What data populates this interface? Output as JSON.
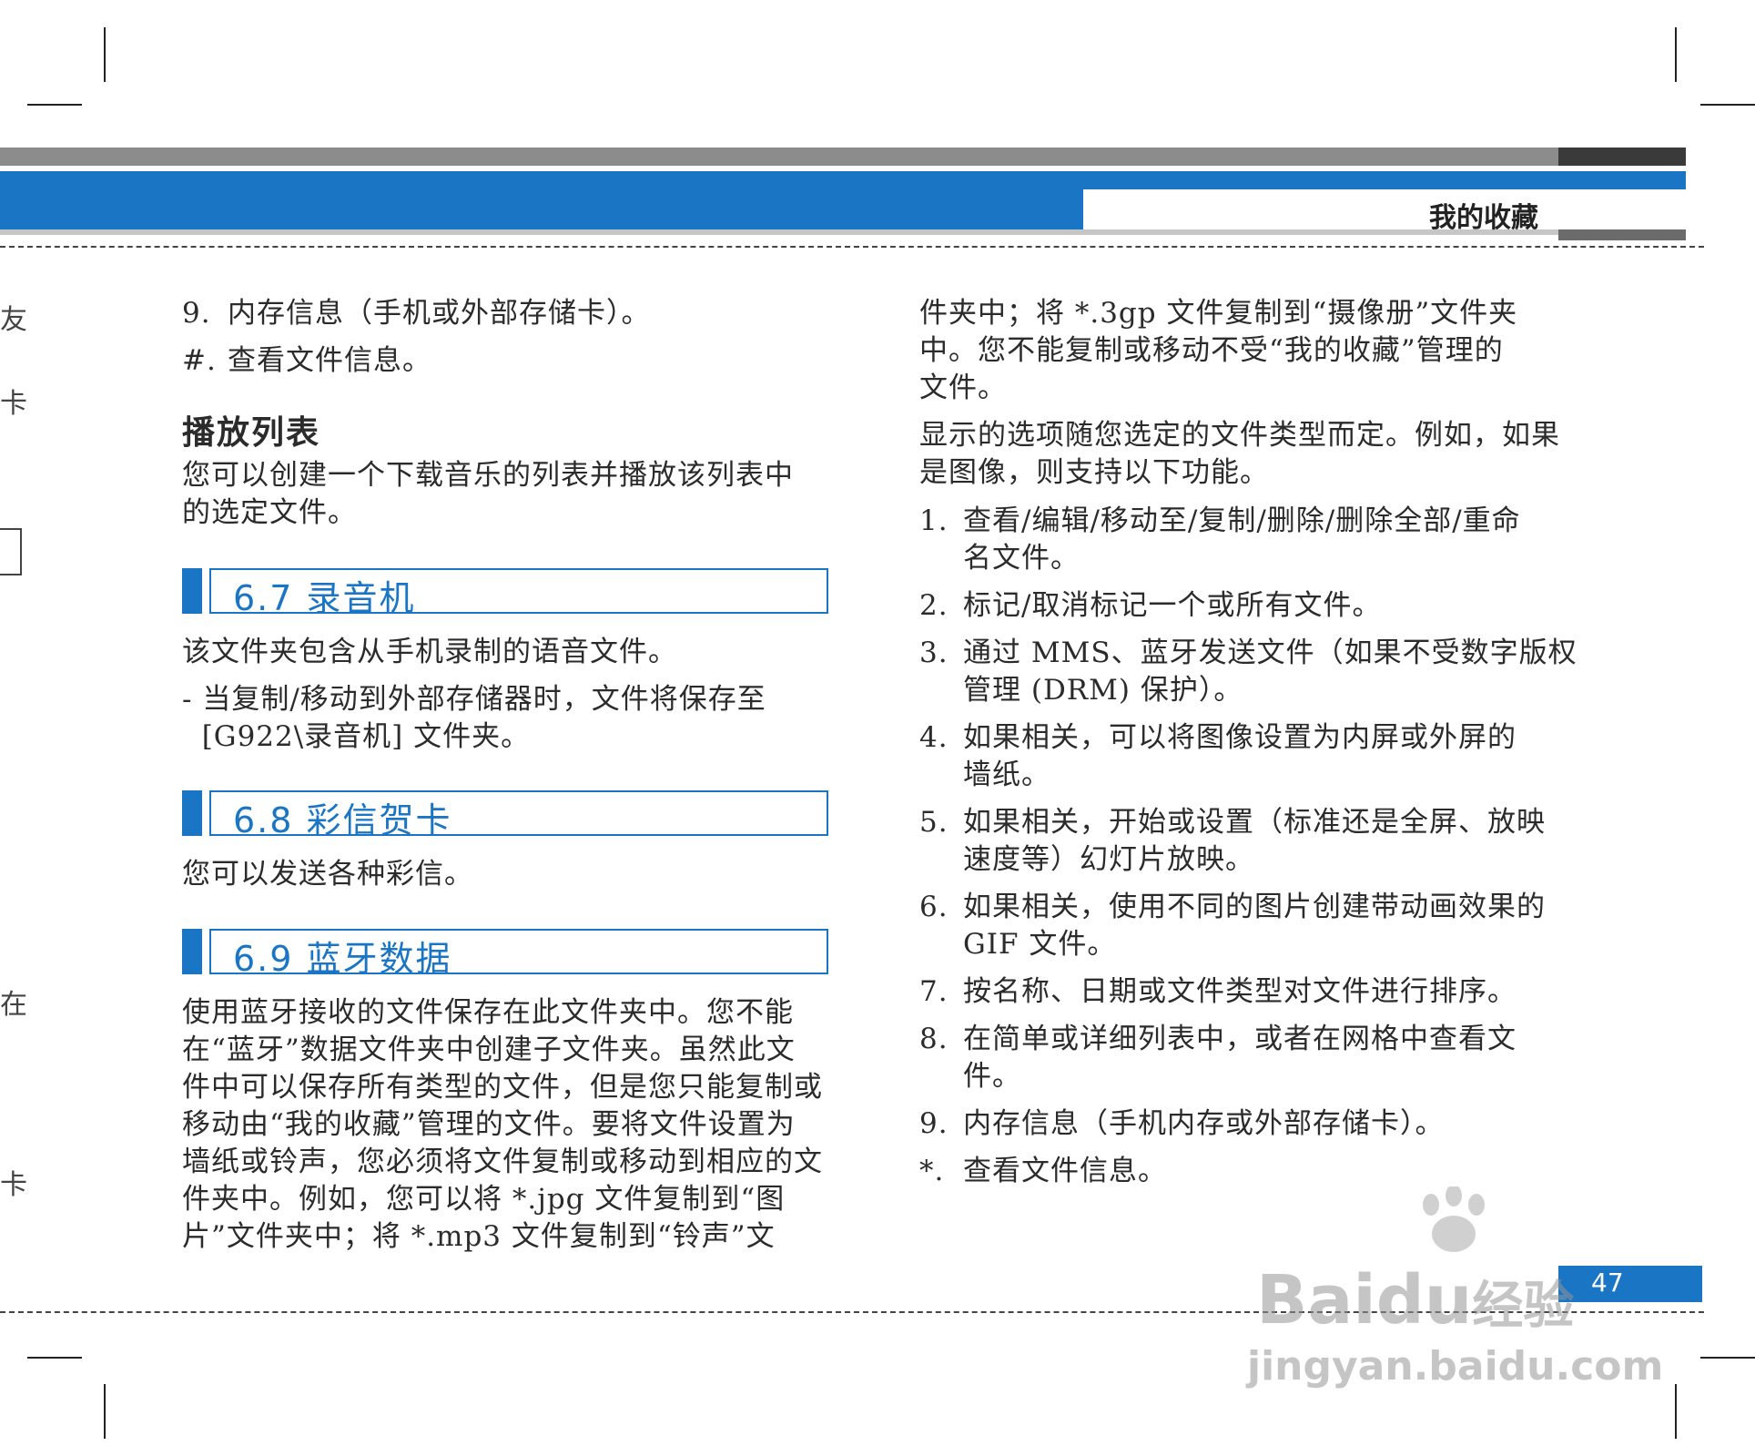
{
  "header": {
    "title": "我的收藏"
  },
  "left_edge": {
    "chars": [
      "友",
      "卡",
      "在",
      "卡"
    ]
  },
  "left": {
    "top_items": [
      {
        "num": "9.",
        "text": "内存信息（手机或外部存储卡）。"
      },
      {
        "num": "#.",
        "text": "查看文件信息。"
      }
    ],
    "playlist_heading": "播放列表",
    "playlist_text": [
      "您可以创建一个下载音乐的列表并播放该列表中",
      "的选定文件。"
    ],
    "sec67": {
      "title": "6.7 录音机",
      "lines": [
        "该文件夹包含从手机录制的语音文件。"
      ],
      "bullet": [
        "- 当复制/移动到外部存储器时，文件将保存至",
        "  [G922\\录音机] 文件夹。"
      ]
    },
    "sec68": {
      "title": "6.8 彩信贺卡",
      "lines": [
        "您可以发送各种彩信。"
      ]
    },
    "sec69": {
      "title": "6.9 蓝牙数据",
      "lines": [
        "使用蓝牙接收的文件保存在此文件夹中。您不能",
        "在“蓝牙”数据文件夹中创建子文件夹。虽然此文",
        "件中可以保存所有类型的文件，但是您只能复制或",
        "移动由“我的收藏”管理的文件。要将文件设置为",
        "墙纸或铃声，您必须将文件复制或移动到相应的文",
        "件夹中。例如，您可以将 *.jpg 文件复制到“图",
        "片”文件夹中；将 *.mp3 文件复制到“铃声”文"
      ]
    }
  },
  "right": {
    "cont_lines": [
      "件夹中；将 *.3gp 文件复制到“摄像册”文件夹",
      "中。您不能复制或移动不受“我的收藏”管理的",
      "文件。"
    ],
    "intro_lines": [
      "显示的选项随您选定的文件类型而定。例如，如果",
      "是图像，则支持以下功能。"
    ],
    "items": [
      {
        "num": "1.",
        "lines": [
          "查看/编辑/移动至/复制/删除/删除全部/重命",
          "名文件。"
        ]
      },
      {
        "num": "2.",
        "lines": [
          "标记/取消标记一个或所有文件。"
        ]
      },
      {
        "num": "3.",
        "lines": [
          "通过 MMS、蓝牙发送文件（如果不受数字版权",
          "管理 (DRM) 保护）。"
        ]
      },
      {
        "num": "4.",
        "lines": [
          "如果相关，可以将图像设置为内屏或外屏的",
          "墙纸。"
        ]
      },
      {
        "num": "5.",
        "lines": [
          "如果相关，开始或设置（标准还是全屏、放映",
          "速度等）幻灯片放映。"
        ]
      },
      {
        "num": "6.",
        "lines": [
          "如果相关，使用不同的图片创建带动画效果的",
          "GIF 文件。"
        ]
      },
      {
        "num": "7.",
        "lines": [
          "按名称、日期或文件类型对文件进行排序。"
        ]
      },
      {
        "num": "8.",
        "lines": [
          "在简单或详细列表中，或者在网格中查看文",
          "件。"
        ]
      },
      {
        "num": "9.",
        "lines": [
          "内存信息（手机内存或外部存储卡）。"
        ]
      },
      {
        "num": "*.",
        "lines": [
          "查看文件信息。"
        ]
      }
    ]
  },
  "footer": {
    "page_number": "47"
  },
  "watermark": {
    "brand": "Bai",
    "brand2": "du",
    "suffix": "经验",
    "url": "jingyan.baidu.com"
  }
}
